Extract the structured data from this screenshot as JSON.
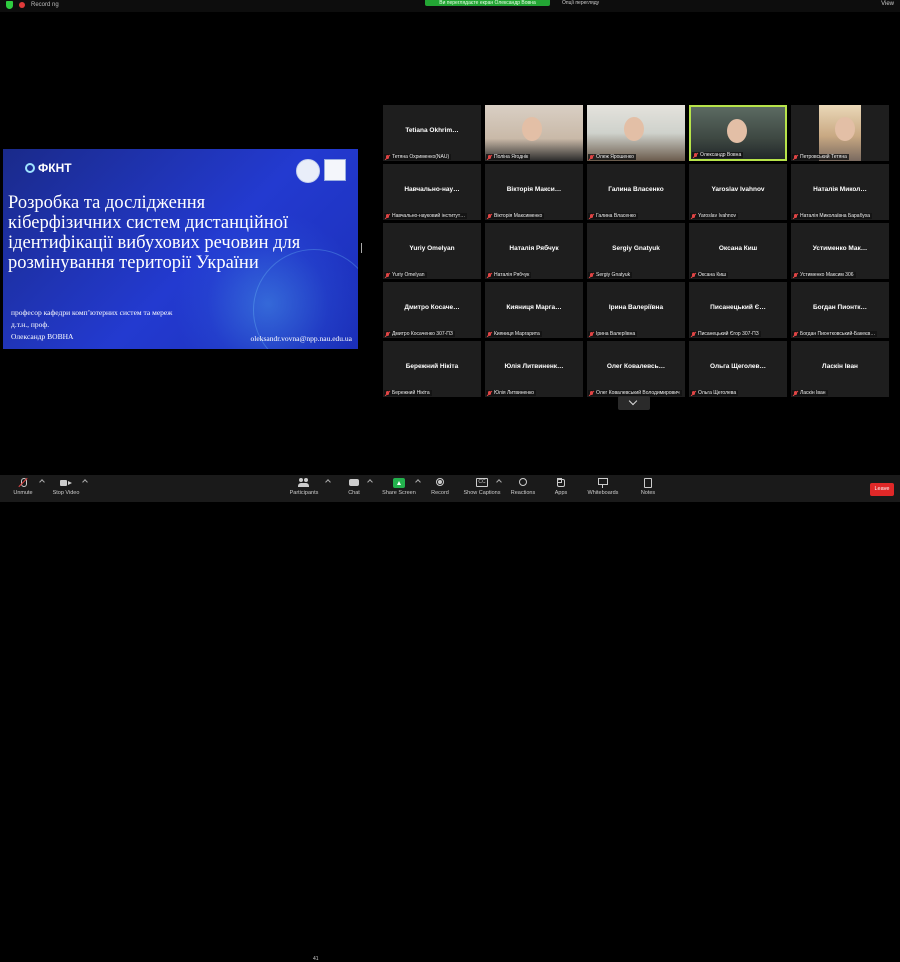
{
  "topbar": {
    "recording_label": "Record ng",
    "banner_text": "Ви переглядаєте екран Олександр Вовна",
    "banner_right": "Опції перегляду",
    "view_label": "View"
  },
  "slide": {
    "logo_text": "ФКНТ",
    "title_lines": [
      "Розробка та дослідження",
      "кіберфізичних систем дистанційної",
      "ідентифікації вибухових речовин для",
      "розмінування території України"
    ],
    "author_lines": [
      "професор кафедри комп’ютерних систем та мереж",
      "д.т.н., проф.",
      "Олександр ВОВНА"
    ],
    "email": "oleksandr.vovna@npp.nau.edu.ua"
  },
  "participants": [
    {
      "name": "Tetiana Okhrim…",
      "label": "Тетяна Охрименко(NAU)",
      "video": null
    },
    {
      "name": "",
      "label": "Поліна Ягоднік",
      "video": "v1"
    },
    {
      "name": "",
      "label": "Олеж Ярошенко",
      "video": "v2"
    },
    {
      "name": "",
      "label": "Олександр Вовна",
      "video": "v3",
      "active": true
    },
    {
      "name": "",
      "label": "Петровський Тетяна",
      "video": "v4"
    },
    {
      "name": "Навчально-нау…",
      "label": "Навчально-науковий інститут…",
      "video": null
    },
    {
      "name": "Вікторія Макси…",
      "label": "Вікторія Максименко",
      "video": null
    },
    {
      "name": "Галина Власенко",
      "label": "Галина Власенко",
      "video": null
    },
    {
      "name": "Yaroslav Ivahnov",
      "label": "Yaroslav Ivahnov",
      "video": null
    },
    {
      "name": "Наталія Микол…",
      "label": "Наталія Миколаївна Барабуха",
      "video": null
    },
    {
      "name": "Yuriy Omelyan",
      "label": "Yuriy Omelyan",
      "video": null
    },
    {
      "name": "Наталія Рябчук",
      "label": "Наталія Рябчук",
      "video": null
    },
    {
      "name": "Sergiy Gnatyuk",
      "label": "Sergiy Gnatyuk",
      "video": null
    },
    {
      "name": "Оксана Киш",
      "label": "Оксана Киш",
      "video": null
    },
    {
      "name": "Устименко Мак…",
      "label": "Устименко Максим 306",
      "video": null
    },
    {
      "name": "Дмитро Косаче…",
      "label": "Дмитро Косаченко 307-ПЗ",
      "video": null
    },
    {
      "name": "Кияниця Марга…",
      "label": "Кияниця Маргарита",
      "video": null
    },
    {
      "name": "Ірина Валеріївна",
      "label": "Ірина Валеріївна",
      "video": null
    },
    {
      "name": "Писанецький Є…",
      "label": "Писанецький Єгор 307-ПЗ",
      "video": null
    },
    {
      "name": "Богдан Пионтк…",
      "label": "Богдан Пионтковський-Бакеєв…",
      "video": null
    },
    {
      "name": "Бережний Нікіта",
      "label": "Бережний Нікіта",
      "video": null
    },
    {
      "name": "Юлія Литвиненк…",
      "label": "Юлія Литвиненко",
      "video": null
    },
    {
      "name": "Олег Ковалевсь…",
      "label": "Олег Ковалевський Володимирович",
      "video": null
    },
    {
      "name": "Ольга Щеголев…",
      "label": "Ольга Щеголева",
      "video": null
    },
    {
      "name": "Ласкін Іван",
      "label": "Ласкін Іван",
      "video": null
    }
  ],
  "toolbar": {
    "unmute": "Unmute",
    "stop_video": "Stop Video",
    "participants": "Participants",
    "participants_count": "41",
    "chat": "Chat",
    "share_screen": "Share Screen",
    "record": "Record",
    "show_captions": "Show Captions",
    "reactions": "Reactions",
    "apps": "Apps",
    "whiteboards": "Whiteboards",
    "notes": "Notes",
    "leave": "Leave"
  }
}
